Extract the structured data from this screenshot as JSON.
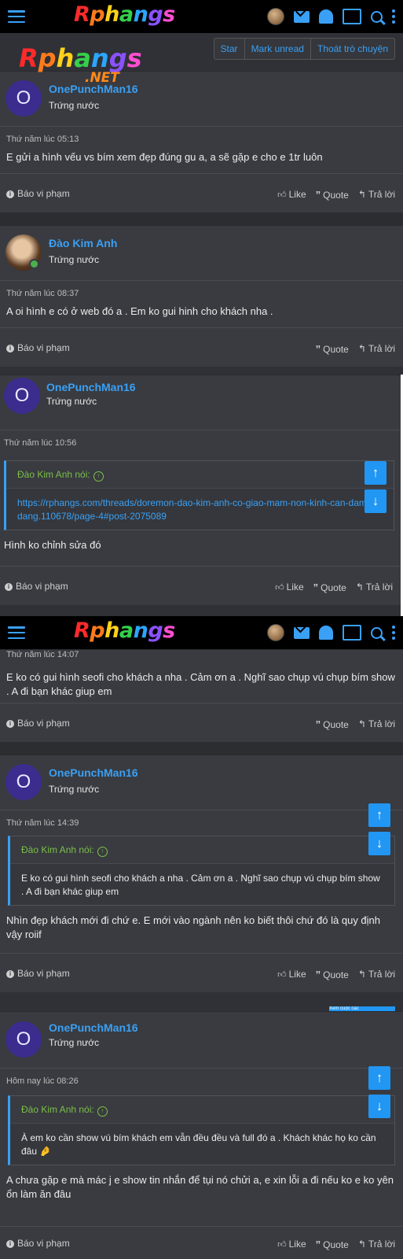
{
  "site": {
    "logo_text": "Rphangs",
    "watermark_net": ".NET"
  },
  "thread_tools": [
    "Star",
    "Mark unread",
    "Thoát trò chuyện"
  ],
  "posts": [
    {
      "author": "OnePunchMan16",
      "avatar_letter": "O",
      "rank": "Trứng nước",
      "date": "Thứ năm lúc 05:13",
      "body": "E gửi a hình vếu vs bím xem đẹp đúng gu a, a sẽ gặp e cho e 1tr luôn",
      "report": "Báo vi phạm",
      "like": "Like",
      "quote": "Quote",
      "reply": "Trả lời"
    },
    {
      "author": "Đào Kim Anh",
      "rank": "Trứng nước",
      "date": "Thứ năm lúc 08:37",
      "body": "A oi hình e có ở web đó a . Em ko gui hinh cho khách nha .",
      "report": "Báo vi phạm",
      "quote": "Quote",
      "reply": "Trả lời"
    },
    {
      "author": "OnePunchMan16",
      "avatar_letter": "O",
      "rank": "Trứng nước",
      "date": "Thứ năm lúc 10:56",
      "quote_author": "Đào Kim Anh nói:",
      "quote_body": "https://rphangs.com/threads/doremon-dao-kim-anh-co-giao-mam-non-kinh-can-dam-dang.110678/page-4#post-2075089",
      "body": "Hình ko chỉnh sửa đó",
      "report": "Báo vi phạm",
      "like": "Like",
      "quote": "Quote",
      "reply": "Trả lời"
    },
    {
      "date": "Thứ năm lúc 14:07",
      "body": "E ko có gui hình seofi cho khách a nha . Cảm ơn a . Nghĩ sao chụp vú chụp bím show . A đi bạn khác giup em",
      "report": "Báo vi phạm",
      "quote": "Quote",
      "reply": "Trả lời"
    },
    {
      "author": "OnePunchMan16",
      "avatar_letter": "O",
      "rank": "Trứng nước",
      "date": "Thứ năm lúc 14:39",
      "quote_author": "Đào Kim Anh nói:",
      "quote_body": "E ko có gui hình seofi cho khách a nha . Cảm ơn a . Nghĩ sao chụp vú chụp bím show . A đi bạn khác giup em",
      "body": "Nhìn đẹp khách mới đi chứ e. E mới vào ngành nên ko biết thôi chứ đó là quy định vậy roiif",
      "report": "Báo vi phạm",
      "like": "Like",
      "quote": "Quote",
      "reply": "Trả lời"
    },
    {
      "author": "OnePunchMan16",
      "avatar_letter": "O",
      "rank": "Trứng nước",
      "date": "Hôm nay lúc 08:26",
      "quote_author": "Đào Kim Anh nói:",
      "quote_body": "À em ko cần show vú bím khách em vẫn đều đều và full đó a . Khách khác họ ko cần đâu 🤌",
      "body": "A chưa gặp e mà mác j e show tin nhắn để tụi nó chửi a, e xin lỗi a đi nếu ko e ko yên ổn làm ăn đâu",
      "report": "Báo vi phạm",
      "like": "Like",
      "quote": "Quote",
      "reply": "Trả lời"
    }
  ],
  "scroll": {
    "up": "↑",
    "down": "↓"
  },
  "badge_text": "Xem cuộc các"
}
